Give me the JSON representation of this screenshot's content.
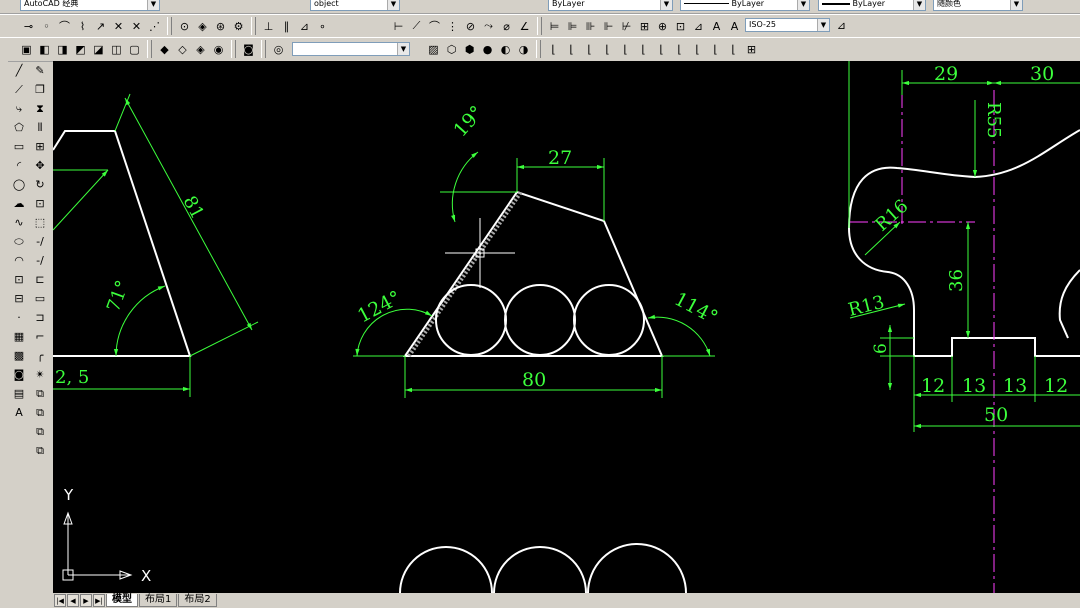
{
  "toolbar_row1": {
    "workspace": "AutoCAD 经典",
    "layer": "object",
    "color": "ByLayer",
    "linetype": "ByLayer",
    "lineweight": "ByLayer",
    "plotstyle": "随颜色"
  },
  "toolbar_row2": {
    "dimstyle": "ISO-25"
  },
  "dimensions": {
    "left_angle": "71°",
    "left_length": "81",
    "left_partial": "2, 5",
    "top_angle": "19°",
    "top_width": "27",
    "left_base_angle": "124°",
    "right_base_angle": "114°",
    "base_width": "80",
    "right_29": "29",
    "right_30": "30",
    "r55": "R55",
    "r16": "R16",
    "r13": "R13",
    "d36": "36",
    "d6": "6",
    "d12a": "12",
    "d13a": "13",
    "d13b": "13",
    "d12b": "12",
    "d50": "50"
  },
  "ucs": {
    "x": "X",
    "y": "Y"
  },
  "tabs": [
    "模型",
    "布局1",
    "布局2"
  ],
  "colors": {
    "dim": "#3cff3c",
    "geom": "#ffffff",
    "center": "#ff40ff",
    "canvas": "#000000"
  }
}
